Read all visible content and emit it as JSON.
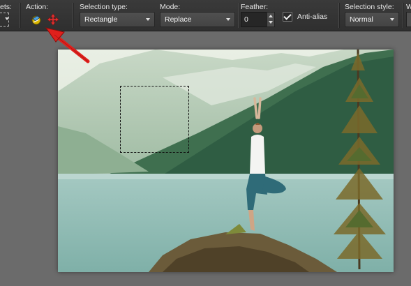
{
  "toolbar": {
    "presets_label": "ets:",
    "action_label": "Action:",
    "selection_type": {
      "label": "Selection type:",
      "value": "Rectangle"
    },
    "mode": {
      "label": "Mode:",
      "value": "Replace"
    },
    "feather": {
      "label": "Feather:",
      "value": "0"
    },
    "antialias": {
      "label": "Anti-alias",
      "checked": true
    },
    "selection_style": {
      "label": "Selection style:",
      "value": "Normal"
    },
    "cut_label": "W"
  },
  "colors": {
    "toolbar_bg": "#333333",
    "workspace_bg": "#6b6b6b",
    "arrow": "#e0201c"
  },
  "icons": {
    "action_1": "magic-selection-icon",
    "action_2": "add-selection-icon"
  }
}
